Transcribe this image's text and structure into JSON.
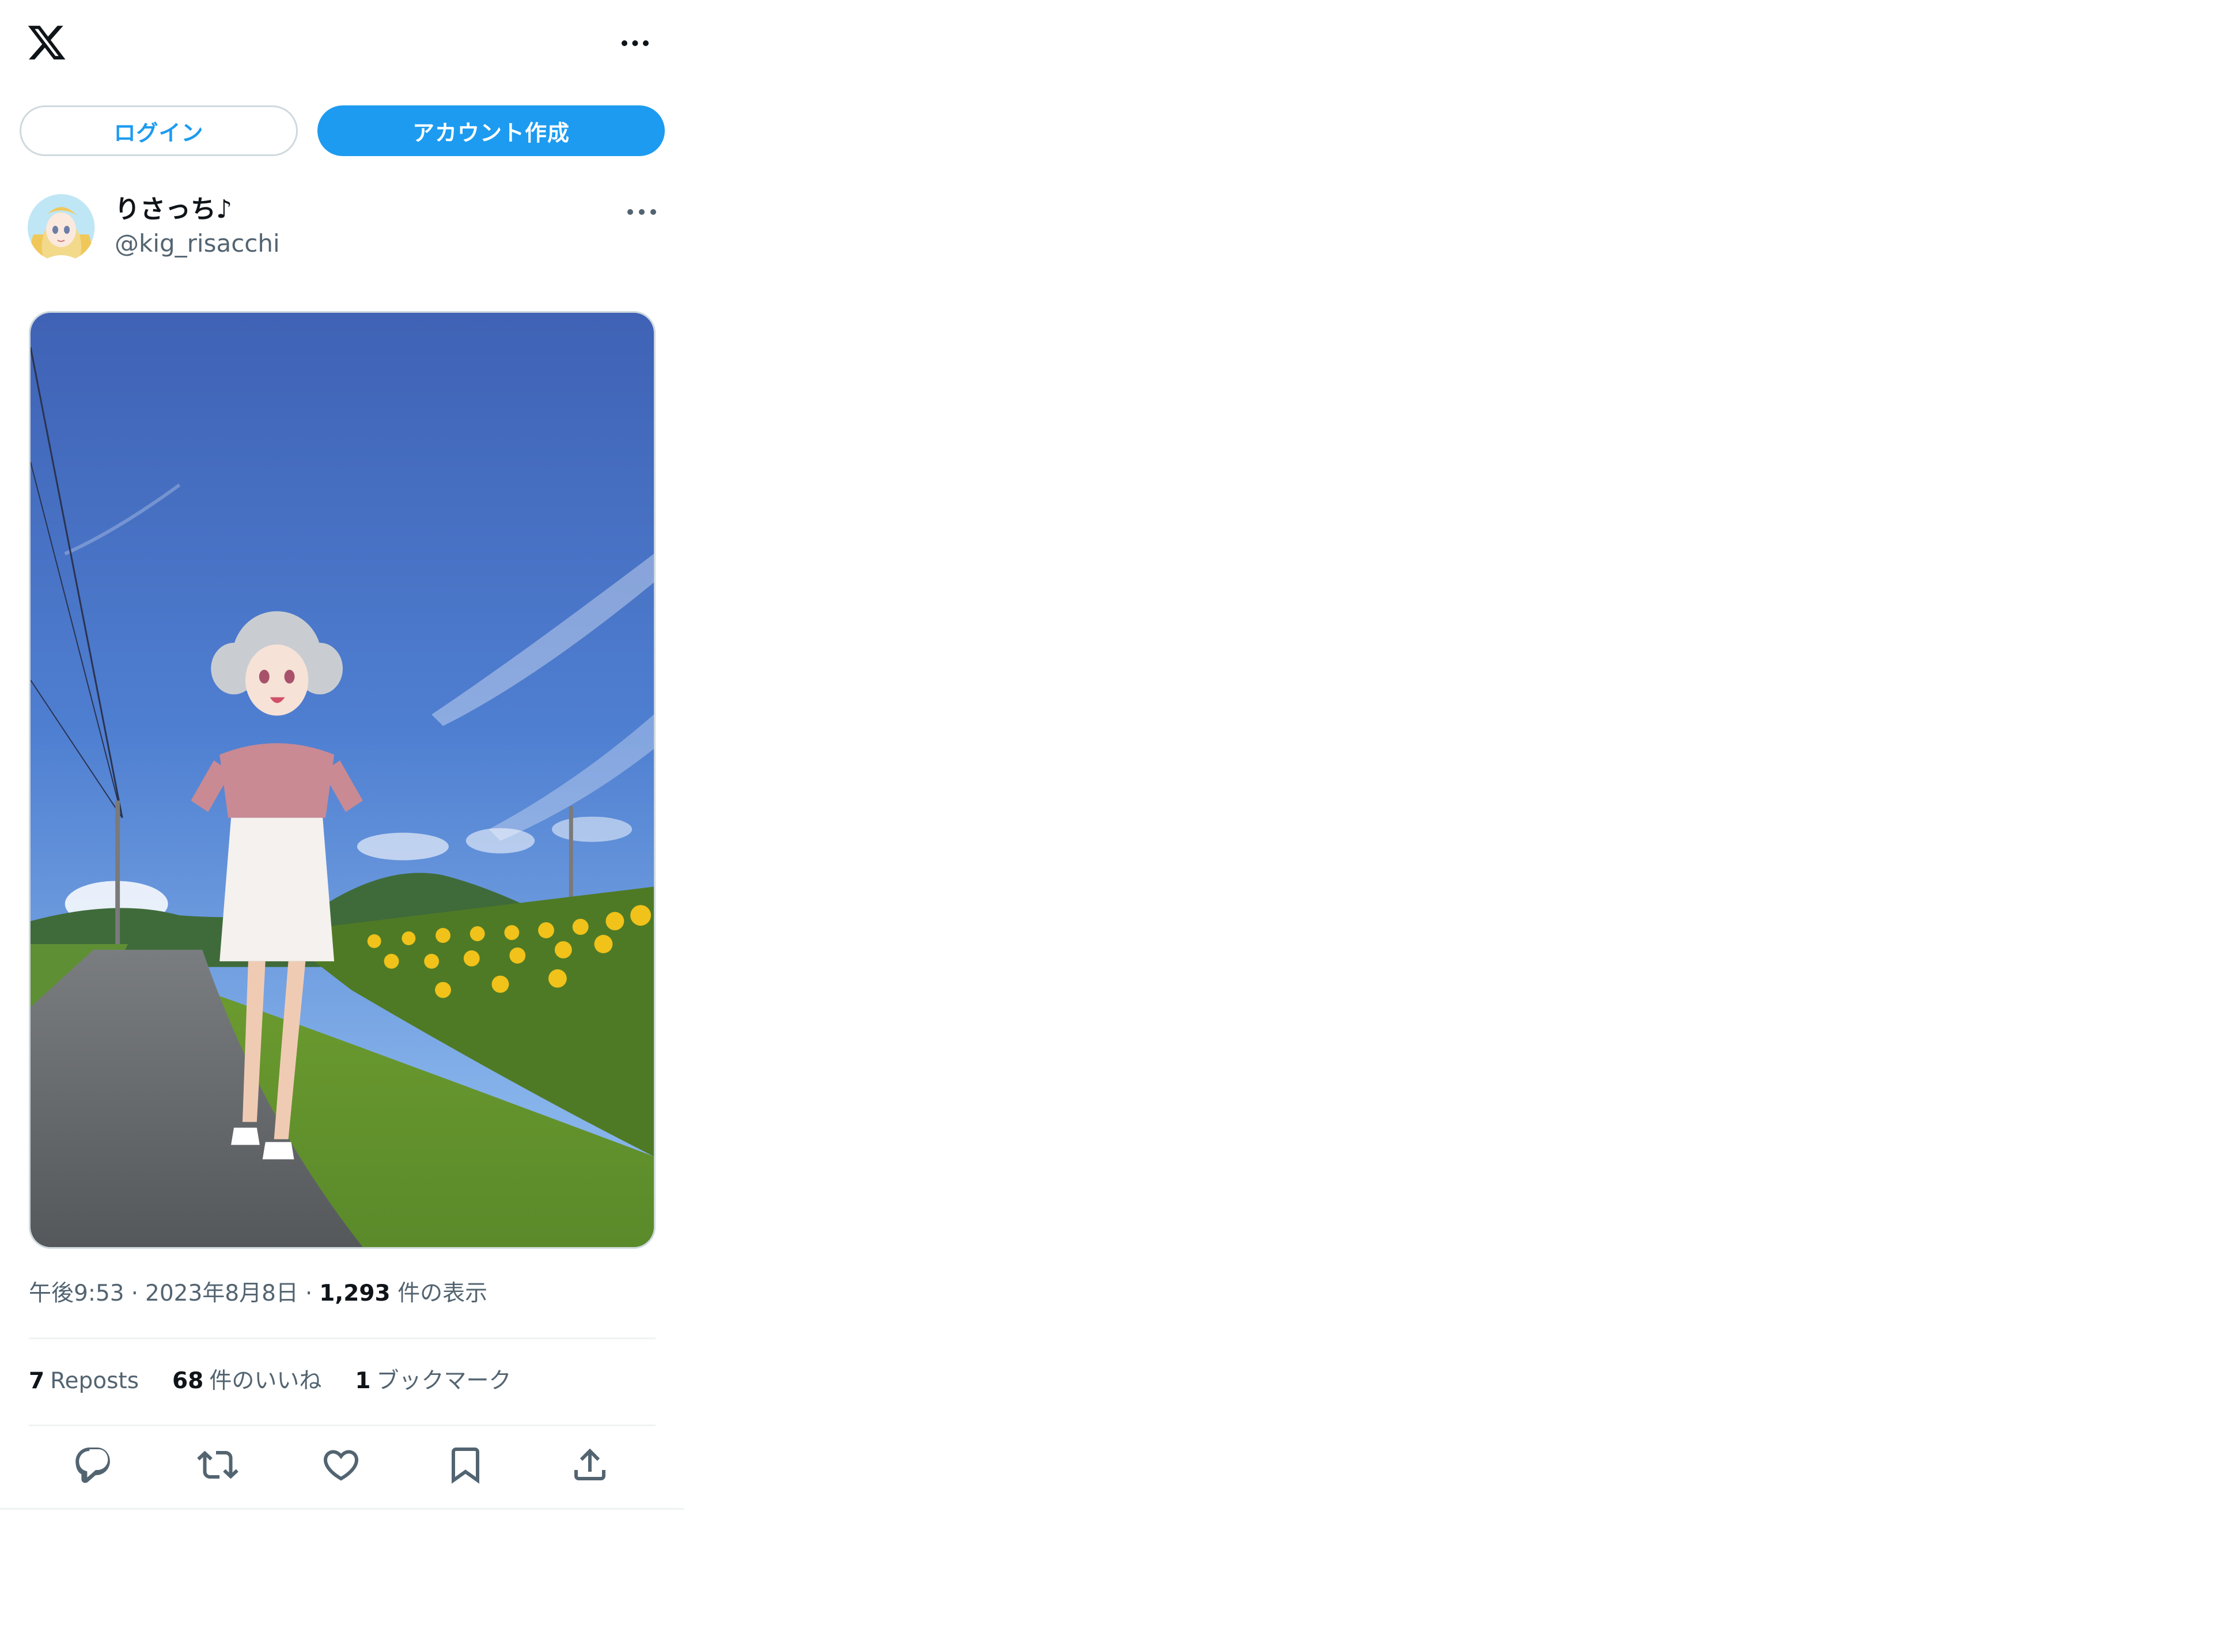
{
  "header": {
    "logo_icon": "x-logo-icon",
    "more_icon": "more-horizontal-icon"
  },
  "auth": {
    "login_label": "ログイン",
    "signup_label": "アカウント作成"
  },
  "post": {
    "author": {
      "display_name": "りさっち♪",
      "handle": "@kig_risacchi",
      "avatar_icon": "avatar-image"
    },
    "more_icon": "more-horizontal-icon",
    "media": {
      "type": "photo"
    },
    "meta": {
      "time": "午後9:53",
      "separator": "·",
      "date": "2023年8月8日",
      "views_count": "1,293",
      "views_label": "件の表示"
    },
    "stats": {
      "reposts_count": "7",
      "reposts_label": "Reposts",
      "likes_count": "68",
      "likes_label": "件のいいね",
      "bookmarks_count": "1",
      "bookmarks_label": "ブックマーク"
    },
    "actions": [
      "reply-icon",
      "repost-icon",
      "like-icon",
      "bookmark-icon",
      "share-icon"
    ]
  },
  "colors": {
    "accent": "#1d9bf0",
    "text_primary": "#0f1419",
    "text_secondary": "#536471",
    "border": "#cfd9de",
    "divider": "#eff3f4"
  }
}
